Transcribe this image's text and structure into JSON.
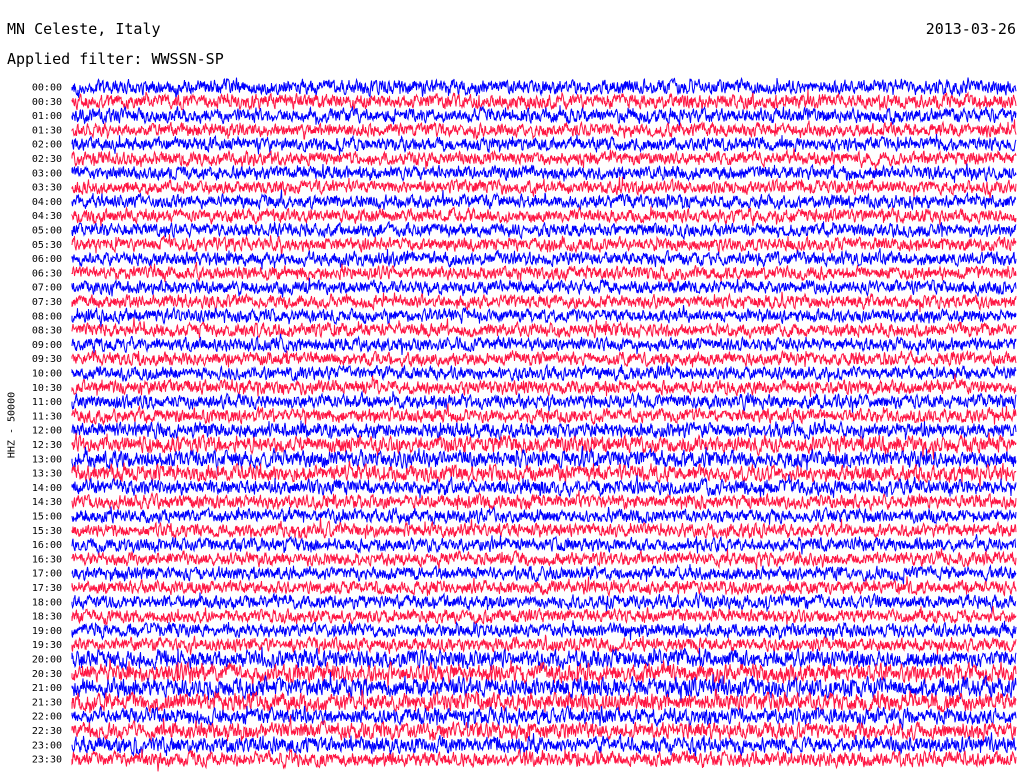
{
  "header": {
    "station": "MN Celeste, Italy",
    "date": "2013-03-26",
    "filter_label": "Applied filter: WWSSN-SP"
  },
  "chart_data": {
    "type": "line",
    "subtype": "helicorder",
    "title": "MN Celeste, Italy",
    "date": "2013-03-26",
    "filter": "WWSSN-SP",
    "ylabel": "HHZ - 50000",
    "ytick_labels": [
      "00:00",
      "00:30",
      "01:00",
      "01:30",
      "02:00",
      "02:30",
      "03:00",
      "03:30",
      "04:00",
      "04:30",
      "05:00",
      "05:30",
      "06:00",
      "06:30",
      "07:00",
      "07:30",
      "08:00",
      "08:30",
      "09:00",
      "09:30",
      "10:00",
      "10:30",
      "11:00",
      "11:30",
      "12:00",
      "12:30",
      "13:00",
      "13:30",
      "14:00",
      "14:30",
      "15:00",
      "15:30",
      "16:00",
      "16:30",
      "17:00",
      "17:30",
      "18:00",
      "18:30",
      "19:00",
      "19:30",
      "20:00",
      "20:30",
      "21:00",
      "21:30",
      "22:00",
      "22:30",
      "23:00",
      "23:30"
    ],
    "trace_colors": [
      "#0000ff",
      "#ff1744"
    ],
    "grid": false,
    "legend": "none",
    "line_noise_level": [
      1.0,
      1.0,
      0.95,
      0.9,
      0.9,
      0.9,
      0.9,
      0.9,
      0.9,
      0.9,
      0.9,
      0.9,
      0.9,
      0.9,
      0.9,
      0.9,
      0.9,
      0.9,
      0.9,
      0.9,
      0.9,
      0.95,
      0.95,
      0.95,
      1.0,
      1.1,
      1.15,
      1.1,
      1.0,
      0.95,
      0.9,
      0.9,
      0.9,
      0.9,
      0.9,
      0.9,
      0.9,
      0.9,
      0.9,
      0.9,
      1.2,
      1.25,
      1.3,
      1.2,
      1.1,
      1.1,
      1.1,
      1.0
    ]
  }
}
